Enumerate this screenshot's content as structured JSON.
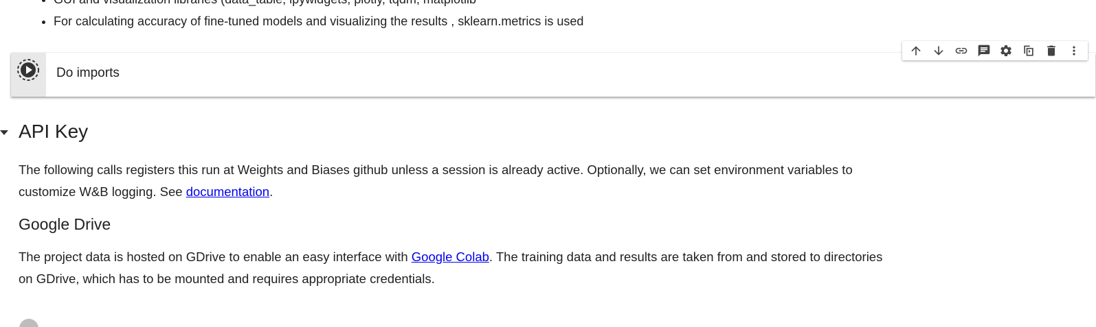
{
  "bullets": [
    "GUI and visualization libraries (data_table, ipywidgets, plotly, tqdm, matplotlib",
    "For calculating accuracy of fine-tuned models and visualizing the results , sklearn.metrics is used"
  ],
  "cell": {
    "title": "Do imports"
  },
  "toolbar": {
    "icons": [
      "arrow-up-icon",
      "arrow-down-icon",
      "link-icon",
      "comment-icon",
      "gear-icon",
      "mirror-cell-icon",
      "trash-icon",
      "more-vert-icon"
    ]
  },
  "section_api": {
    "heading": "API Key",
    "para_before": "The following calls registers this run at Weights and Biases github unless a session is already active. Optionally, we can set environment variables to customize W&B logging. See ",
    "link": "documentation",
    "para_after": "."
  },
  "section_drive": {
    "heading": "Google Drive",
    "para_before": "The project data is hosted on GDrive to enable an easy interface with ",
    "link": "Google Colab",
    "para_after": ". The training data and results are taken from and stored to directories on GDrive, which has to be mounted and requires appropriate credentials."
  },
  "colors": {
    "link": "#0000ee",
    "gutter": "#e8e8e8"
  }
}
